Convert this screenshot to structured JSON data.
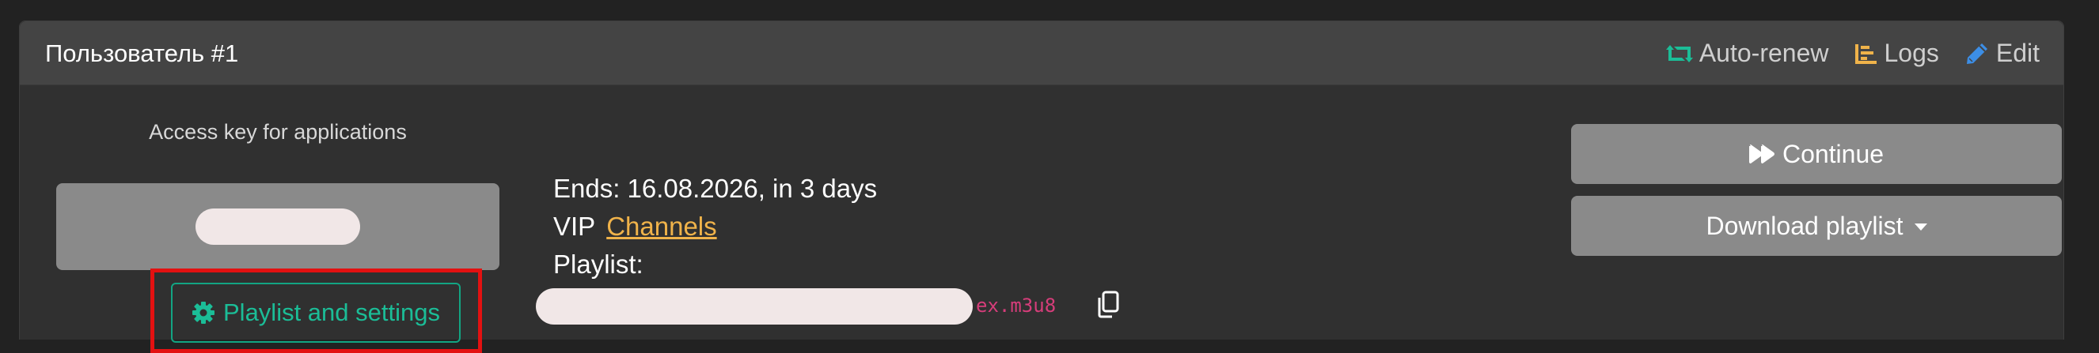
{
  "card": {
    "title": "Пользователь #1",
    "actions": {
      "auto_renew": "Auto-renew",
      "logs": "Logs",
      "edit": "Edit"
    }
  },
  "access": {
    "label": "Access key for applications"
  },
  "playlist_settings_button": "Playlist and settings",
  "subscription": {
    "ends": "Ends: 16.08.2026, in 3 days",
    "plan": "VIP",
    "channels_link": "Channels",
    "playlist_label": "Playlist:",
    "playlist_url_suffix": "ex.m3u8"
  },
  "buttons": {
    "continue": "Continue",
    "download_playlist": "Download playlist"
  },
  "colors": {
    "auto_renew_icon": "#1bbd97",
    "logs_icon": "#f0b34a",
    "edit_icon": "#3c8ee6",
    "accent_green": "#12a583",
    "link_orange": "#f0b34a",
    "url_pink": "#d63d7a"
  },
  "icons": {
    "auto_renew": "retweet-icon",
    "logs": "bar-chart-icon",
    "edit": "pencil-icon",
    "settings": "gear-icon",
    "copy": "copy-icon",
    "continue": "fast-forward-icon",
    "dropdown": "caret-down-icon"
  }
}
